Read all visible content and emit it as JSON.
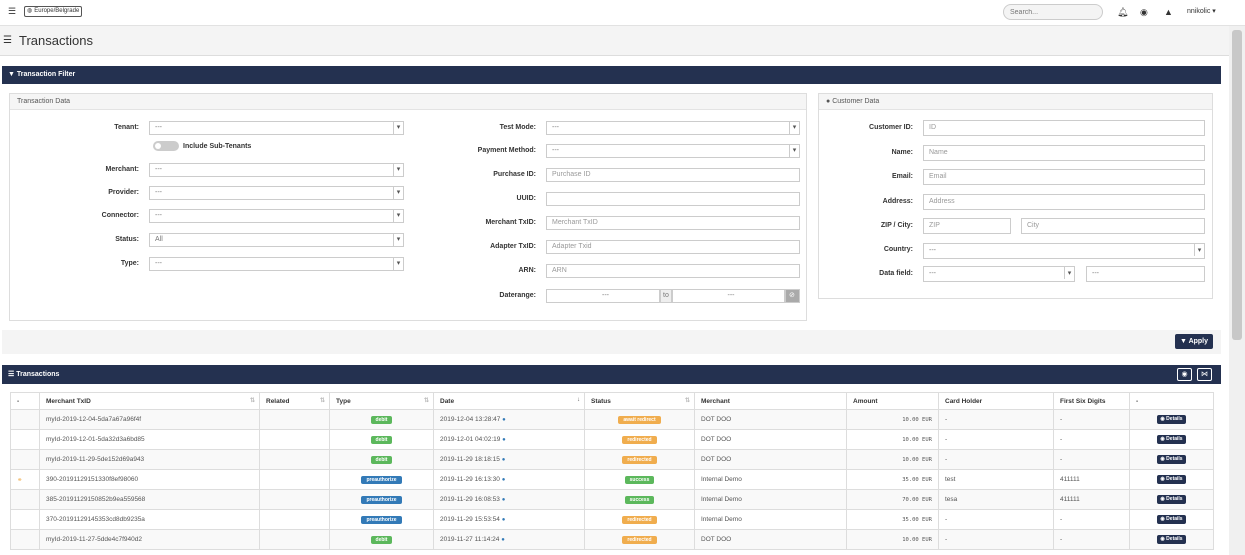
{
  "topbar": {
    "timezone": "Europe/Belgrade",
    "search_placeholder": "Search...",
    "username": "nnikolic"
  },
  "page": {
    "title": "Transactions"
  },
  "filter_panel": {
    "title": "Transaction Filter",
    "transaction_data": {
      "legend": "Transaction Data",
      "tenant_label": "Tenant:",
      "tenant_value": "---",
      "include_subtenants": "Include Sub-Tenants",
      "merchant_label": "Merchant:",
      "merchant_value": "---",
      "provider_label": "Provider:",
      "provider_value": "---",
      "connector_label": "Connector:",
      "connector_value": "---",
      "status_label": "Status:",
      "status_value": "All",
      "type_label": "Type:",
      "type_value": "---",
      "test_mode_label": "Test Mode:",
      "test_mode_value": "---",
      "payment_method_label": "Payment Method:",
      "payment_method_value": "---",
      "purchase_id_label": "Purchase ID:",
      "purchase_id_placeholder": "Purchase ID",
      "uuid_label": "UUID:",
      "merchant_txid_label": "Merchant TxID:",
      "merchant_txid_placeholder": "Merchant TxID",
      "adapter_txid_label": "Adapter TxID:",
      "adapter_txid_placeholder": "Adapter Txid",
      "arn_label": "ARN:",
      "arn_placeholder": "ARN",
      "daterange_label": "Daterange:",
      "date_from": "---",
      "date_to_sep": "to",
      "date_to": "---"
    },
    "customer_data": {
      "legend": "Customer Data",
      "customer_id_label": "Customer ID:",
      "customer_id_placeholder": "ID",
      "name_label": "Name:",
      "name_placeholder": "Name",
      "email_label": "Email:",
      "email_placeholder": "Email",
      "address_label": "Address:",
      "address_placeholder": "Address",
      "zip_city_label": "ZIP / City:",
      "zip_placeholder": "ZIP",
      "city_placeholder": "City",
      "country_label": "Country:",
      "country_value": "---",
      "data_field_label": "Data field:",
      "data_field_value": "---",
      "data_field_input": "---"
    },
    "apply_label": "Apply"
  },
  "transactions": {
    "title": "Transactions",
    "columns": [
      "-",
      "Merchant TxID",
      "Related",
      "Type",
      "Date",
      "Status",
      "Merchant",
      "Amount",
      "Card Holder",
      "First Six Digits",
      "-"
    ],
    "details_label": "Details",
    "rows": [
      {
        "merchant_txid": "myId-2019-12-04-5da7a67a96f4f",
        "type": "debit",
        "date": "2019-12-04 13:28:47",
        "status": "await_redirect",
        "merchant": "DOT DOO",
        "amount": "10.00 EUR",
        "card_holder": "-",
        "first_six": "-"
      },
      {
        "merchant_txid": "myId-2019-12-01-5da32d3a6bd85",
        "type": "debit",
        "date": "2019-12-01 04:02:19",
        "status": "redirected",
        "merchant": "DOT DOO",
        "amount": "10.00 EUR",
        "card_holder": "-",
        "first_six": "-"
      },
      {
        "merchant_txid": "myId-2019-11-29-5de152d69a943",
        "type": "debit",
        "date": "2019-11-29 18:18:15",
        "status": "redirected",
        "merchant": "DOT DOO",
        "amount": "10.00 EUR",
        "card_holder": "-",
        "first_six": "-"
      },
      {
        "merchant_txid": "390-20191129151330f8ef98060",
        "type": "preauthorize",
        "date": "2019-11-29 16:13:30",
        "status": "success",
        "merchant": "Internal Demo",
        "amount": "35.00 EUR",
        "card_holder": "test",
        "first_six": "411111"
      },
      {
        "merchant_txid": "385-20191129150852b9ea559568",
        "type": "preauthorize",
        "date": "2019-11-29 16:08:53",
        "status": "success",
        "merchant": "Internal Demo",
        "amount": "70.00 EUR",
        "card_holder": "tesa",
        "first_six": "411111"
      },
      {
        "merchant_txid": "370-20191129145353cd8db9235a",
        "type": "preauthorize",
        "date": "2019-11-29 15:53:54",
        "status": "redirected",
        "merchant": "Internal Demo",
        "amount": "35.00 EUR",
        "card_holder": "-",
        "first_six": "-"
      },
      {
        "merchant_txid": "myId-2019-11-27-5dde4c7f940d2",
        "type": "debit",
        "date": "2019-11-27 11:14:24",
        "status": "redirected",
        "merchant": "DOT DOO",
        "amount": "10.00 EUR",
        "card_holder": "-",
        "first_six": "-"
      }
    ]
  },
  "colors": {
    "navy": "#243150",
    "success": "#5cb85c",
    "info": "#337ab7",
    "warning": "#f0ad4e"
  }
}
